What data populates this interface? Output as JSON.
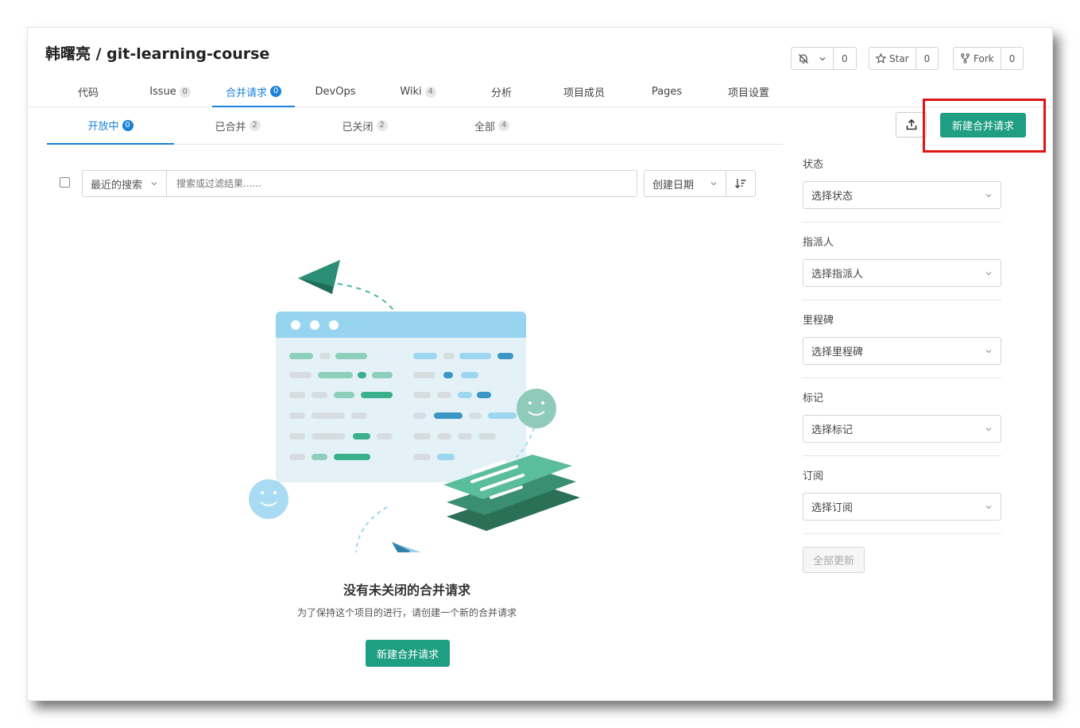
{
  "repo": {
    "title": "韩曙亮 / git-learning-course"
  },
  "actions": {
    "watch": {
      "count": "0"
    },
    "star": {
      "label": "Star",
      "count": "0"
    },
    "fork": {
      "label": "Fork",
      "count": "0"
    }
  },
  "tabs": [
    {
      "label": "代码",
      "badge": ""
    },
    {
      "label": "Issue",
      "badge": "0"
    },
    {
      "label": "合并请求",
      "badge": "0"
    },
    {
      "label": "DevOps",
      "badge": ""
    },
    {
      "label": "Wiki",
      "badge": "4"
    },
    {
      "label": "分析",
      "badge": ""
    },
    {
      "label": "项目成员",
      "badge": ""
    },
    {
      "label": "Pages",
      "badge": ""
    },
    {
      "label": "项目设置",
      "badge": ""
    }
  ],
  "subtabs": [
    {
      "label": "开放中",
      "badge": "0"
    },
    {
      "label": "已合并",
      "badge": "2"
    },
    {
      "label": "已关闭",
      "badge": "2"
    },
    {
      "label": "全部",
      "badge": "4"
    }
  ],
  "toolbar": {
    "new_mr_label": "新建合并请求"
  },
  "search": {
    "recent_label": "最近的搜索",
    "placeholder": "搜索或过滤结果......"
  },
  "sort": {
    "label": "创建日期"
  },
  "empty": {
    "title": "没有未关闭的合并请求",
    "desc": "为了保持这个项目的进行，请创建一个新的合并请求",
    "button": "新建合并请求"
  },
  "filters": [
    {
      "label": "状态",
      "placeholder": "选择状态"
    },
    {
      "label": "指派人",
      "placeholder": "选择指派人"
    },
    {
      "label": "里程碑",
      "placeholder": "选择里程碑"
    },
    {
      "label": "标记",
      "placeholder": "选择标记"
    },
    {
      "label": "订阅",
      "placeholder": "选择订阅"
    }
  ],
  "update_all": "全部更新",
  "colors": {
    "accent": "#1a82d8",
    "primary_green": "#1f9e82",
    "highlight_red": "#e01515"
  }
}
